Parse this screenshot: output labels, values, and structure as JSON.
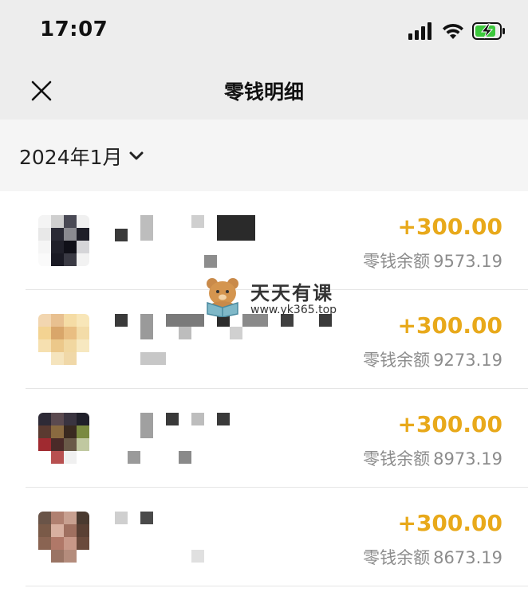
{
  "status_bar": {
    "time": "17:07",
    "icons": [
      "cellular-signal-icon",
      "wifi-icon",
      "battery-charging-icon"
    ]
  },
  "nav": {
    "title": "零钱明细",
    "close_icon": "close-icon"
  },
  "month_filter": {
    "label": "2024年1月",
    "icon": "chevron-down-icon"
  },
  "transactions": [
    {
      "amount": "+300.00",
      "balance_label": "零钱余额",
      "balance": "9573.19"
    },
    {
      "amount": "+300.00",
      "balance_label": "零钱余额",
      "balance": "9273.19"
    },
    {
      "amount": "+300.00",
      "balance_label": "零钱余额",
      "balance": "8973.19"
    },
    {
      "amount": "+300.00",
      "balance_label": "零钱余额",
      "balance": "8673.19"
    }
  ],
  "watermark": {
    "title": "天天有课",
    "url": "www.yk365.top"
  },
  "colors": {
    "amount": "#e8a91b",
    "header_bg": "#ededed",
    "month_bg": "#f5f5f5",
    "muted_text": "#8c8c8c",
    "battery": "#3cc83c"
  }
}
